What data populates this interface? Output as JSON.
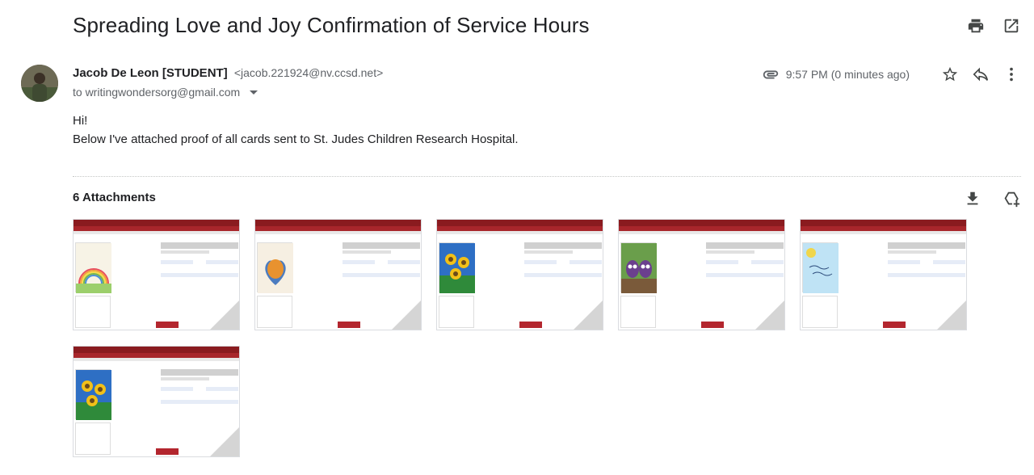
{
  "email": {
    "subject": "Spreading Love and Joy Confirmation of Service Hours",
    "sender_name": "Jacob De Leon [STUDENT]",
    "sender_email": "<jacob.221924@nv.ccsd.net>",
    "to": "to writingwondersorg@gmail.com",
    "time": "9:57 PM (0 minutes ago)",
    "body_line1": "Hi!",
    "body_line2": "Below I've attached proof of all cards sent to St. Judes Children Research Hospital."
  },
  "attachments": {
    "title": "6 Attachments",
    "items": [
      {
        "theme": "rainbow",
        "colors": [
          "#f7f3e6",
          "#e84f5f",
          "#7ab648"
        ]
      },
      {
        "theme": "handprint",
        "colors": [
          "#f6efe2",
          "#e8922f",
          "#4b7cc0"
        ]
      },
      {
        "theme": "sunflower",
        "colors": [
          "#2e6fc4",
          "#f2c018",
          "#2f8a3a"
        ]
      },
      {
        "theme": "owls",
        "colors": [
          "#6a9e4b",
          "#6b3f8e",
          "#efe3c8"
        ]
      },
      {
        "theme": "sky",
        "colors": [
          "#bfe3f5",
          "#f0d64b",
          "#ffffff"
        ]
      },
      {
        "theme": "sunflower",
        "colors": [
          "#2e6fc4",
          "#f2c018",
          "#2f8a3a"
        ]
      }
    ]
  },
  "icons": {
    "print": "print-icon",
    "open": "open-in-new-icon",
    "attach": "paperclip-icon",
    "star": "star-icon",
    "reply": "reply-icon",
    "more": "more-vert-icon",
    "download": "download-icon",
    "drive": "add-to-drive-icon"
  }
}
